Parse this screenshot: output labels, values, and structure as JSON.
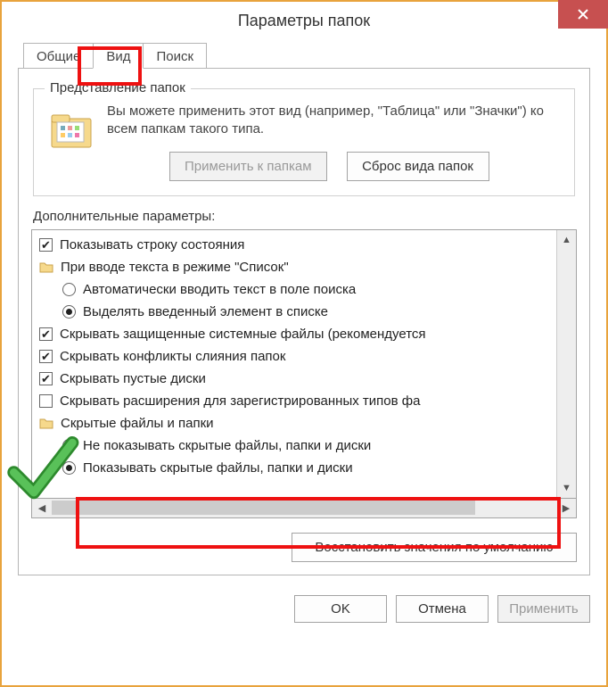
{
  "titlebar": {
    "title": "Параметры папок"
  },
  "tabs": {
    "general": "Общие",
    "view": "Вид",
    "search": "Поиск"
  },
  "group": {
    "title": "Представление папок",
    "text": "Вы можете применить этот вид (например, \"Таблица\" или \"Значки\") ко всем папкам такого типа.",
    "apply": "Применить к папкам",
    "reset": "Сброс вида папок"
  },
  "advanced_label": "Дополнительные параметры:",
  "items": {
    "status_bar": "Показывать строку состояния",
    "list_mode": "При вводе текста в режиме \"Список\"",
    "auto_search": "Автоматически вводить текст в поле поиска",
    "select_item": "Выделять введенный элемент в списке",
    "hide_protected": "Скрывать защищенные системные файлы (рекомендуется",
    "hide_merge": "Скрывать конфликты слияния папок",
    "hide_empty": "Скрывать пустые диски",
    "hide_ext": "Скрывать расширения для зарегистрированных типов фа",
    "hidden_group": "Скрытые файлы и папки",
    "dont_show": "Не показывать скрытые файлы, папки и диски",
    "show": "Показывать скрытые файлы, папки и диски"
  },
  "restore": "Восстановить значения по умолчанию",
  "buttons": {
    "ok": "OK",
    "cancel": "Отмена",
    "apply": "Применить"
  }
}
